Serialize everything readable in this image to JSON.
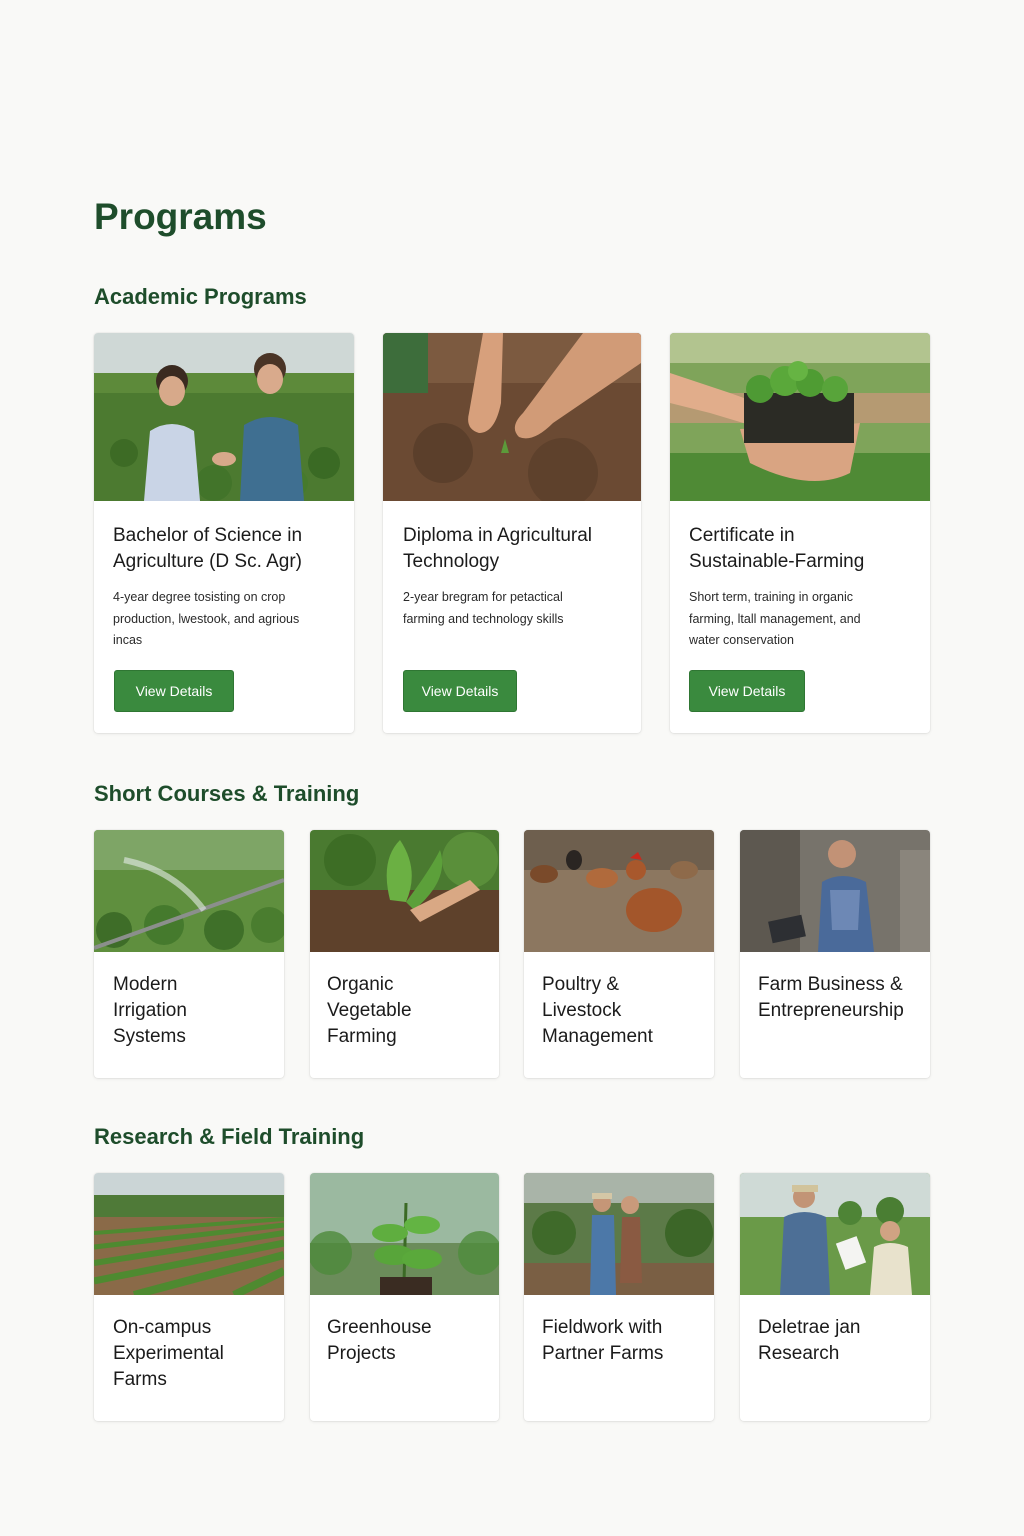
{
  "page": {
    "title": "Programs"
  },
  "academic": {
    "heading": "Academic Programs",
    "cards": [
      {
        "title_line1": "Bachelor of Science in",
        "title_line2": "Agriculture (D Sc. Agr)",
        "desc_line1": "4-year degree tosisting on crop",
        "desc_line2": "production, lwestook, and agrious",
        "desc_line3": "incas",
        "button": "View Details"
      },
      {
        "title_line1": "Diploma in Agricultural",
        "title_line2": "Technology",
        "desc_line1": "2-year bregram for petactical",
        "desc_line2": "farming and technology skills",
        "desc_line3": "",
        "button": "View Details"
      },
      {
        "title_line1": "Certificate in",
        "title_line2": "Sustainable-Farming",
        "desc_line1": "Short term, training in organic",
        "desc_line2": "farming, ltall management, and",
        "desc_line3": "water conservation",
        "button": "View Details"
      }
    ]
  },
  "short_courses": {
    "heading": "Short Courses & Training",
    "cards": [
      {
        "line1": "Modern",
        "line2": "Irrigation",
        "line3": "Systems"
      },
      {
        "line1": "Organic",
        "line2": "Vegetable",
        "line3": "Farming"
      },
      {
        "line1": "Poultry &",
        "line2": "Livestock",
        "line3": "Management"
      },
      {
        "line1": "Farm Business &",
        "line2": "Entrepreneurship",
        "line3": ""
      }
    ]
  },
  "research": {
    "heading": "Research & Field Training",
    "cards": [
      {
        "line1": "On-campus",
        "line2": "Experimental",
        "line3": "Farms"
      },
      {
        "line1": "Greenhouse",
        "line2": "Projects",
        "line3": ""
      },
      {
        "line1": "Fieldwork with",
        "line2": "Partner Farms",
        "line3": ""
      },
      {
        "line1": "Deletrae jan",
        "line2": "Research",
        "line3": ""
      }
    ]
  },
  "colors": {
    "heading_green": "#1e4d2b",
    "button_green": "#3a8a3e",
    "background": "#f9f9f7"
  }
}
